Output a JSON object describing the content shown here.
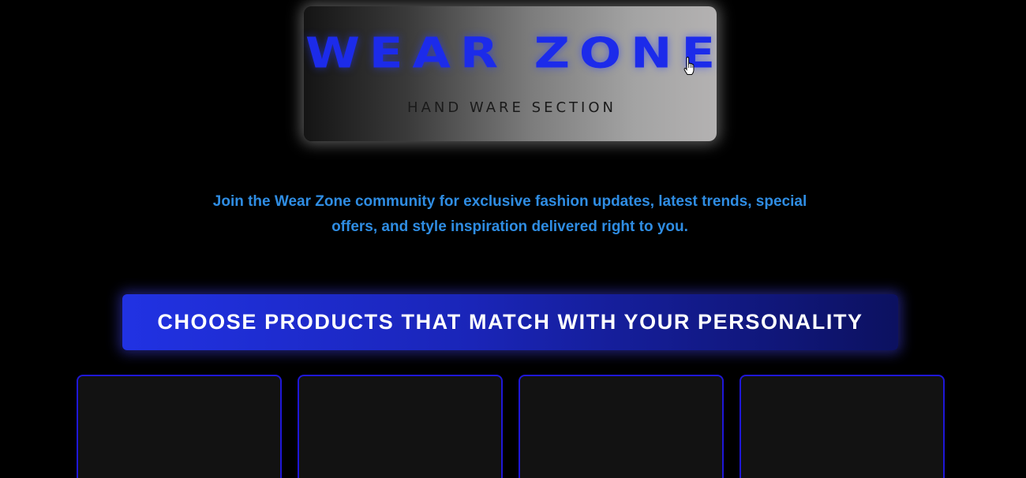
{
  "header": {
    "brand": "WEAR ZONE",
    "tagline": "HAND WARE SECTION"
  },
  "intro": {
    "text": "Join the Wear Zone community for exclusive fashion updates, latest trends, special offers, and style inspiration delivered right to you."
  },
  "cta": {
    "label": "CHOOSE PRODUCTS THAT MATCH WITH YOUR PERSONALITY"
  },
  "products": {
    "cards": [
      {},
      {},
      {},
      {}
    ]
  },
  "icons": {
    "cursor": "hand-pointer-cursor-icon"
  },
  "colors": {
    "background": "#000000",
    "brand_blue": "#1c2bea",
    "intro_text": "#2f8de3",
    "cta_start": "#2132e3",
    "cta_end": "#0c1160",
    "card_border": "#1f17d8",
    "card_fill": "#121212"
  }
}
